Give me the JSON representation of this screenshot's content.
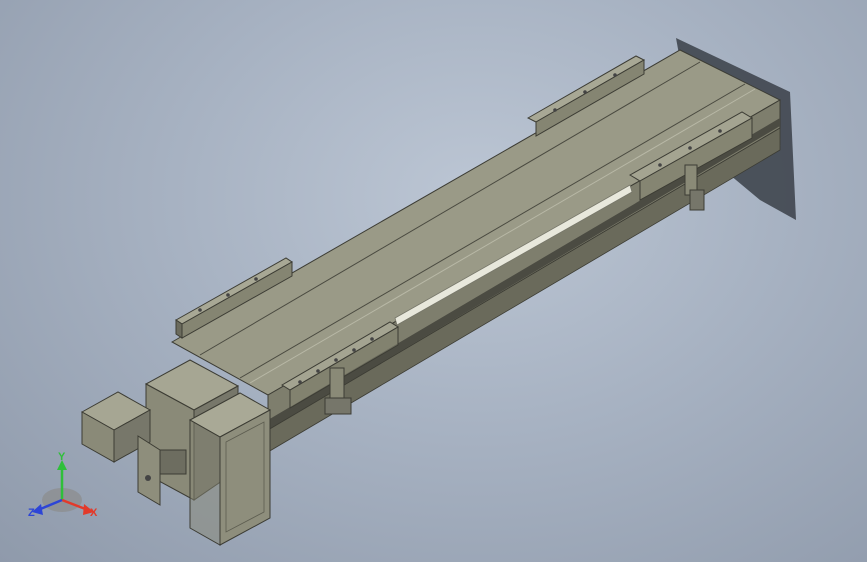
{
  "model": {
    "name_icon": "linear-actuator-module",
    "body_color": "#8e8e7c",
    "top_color": "#9b9b88",
    "dark_color": "#5d5d50"
  },
  "triad": {
    "x_label": "X",
    "y_label": "Y",
    "z_label": "Z",
    "x_color": "#e23a2a",
    "y_color": "#2fbf3a",
    "z_color": "#2d45d6"
  }
}
